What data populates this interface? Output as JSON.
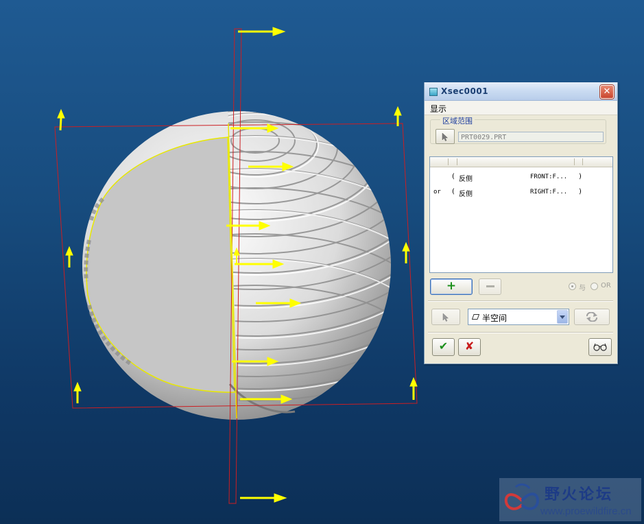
{
  "dialog": {
    "title": "Xsec0001",
    "close_glyph": "✕",
    "menu": [
      "显示"
    ],
    "region_scope": {
      "legend": "区域范围",
      "reference_value": "PRT0029.PRT"
    },
    "conditions": [
      {
        "prefix": "",
        "open": "(",
        "side": "反侧",
        "plane": "FRONT:F...",
        "close": ")"
      },
      {
        "prefix": "or",
        "open": "(",
        "side": "反侧",
        "plane": "RIGHT:F...",
        "close": ")"
      }
    ],
    "add_glyph": "+",
    "radio_and_label": "与",
    "radio_or_label": "OR",
    "boundary_type": "半空间",
    "ok_glyph": "✔",
    "cancel_glyph": "✘"
  },
  "watermark": {
    "text": "野火论坛",
    "url": "www.proewildfire.cn"
  },
  "colors": {
    "arrow": "#ffff00",
    "plane_outline": "#cc1e22",
    "model": "#d6d6d6",
    "background_top": "#1f5a92",
    "background_bottom": "#0c2f56"
  }
}
